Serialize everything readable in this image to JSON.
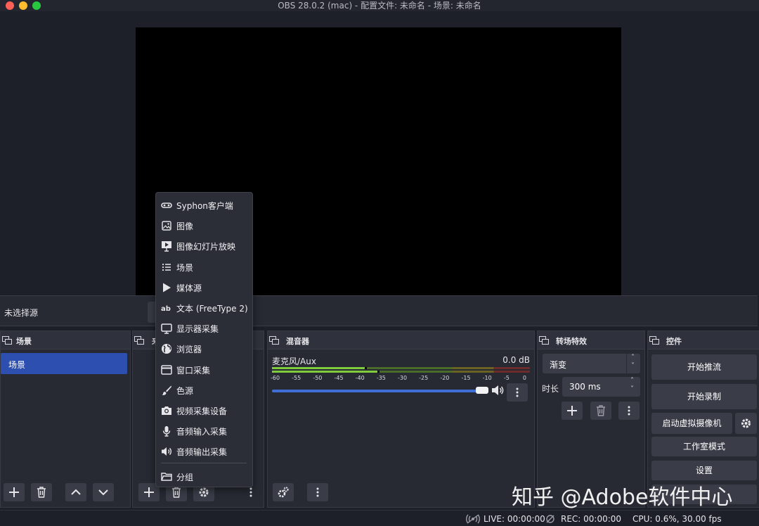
{
  "window": {
    "title": "OBS 28.0.2 (mac) - 配置文件: 未命名 - 场景: 未命名"
  },
  "source_bar": {
    "no_source": "未选择源"
  },
  "docks": {
    "scenes": {
      "title": "场景",
      "items": [
        {
          "label": "场景"
        }
      ]
    },
    "sources": {
      "title": "来"
    },
    "mixer": {
      "title": "混音器",
      "track": {
        "name": "麦克风/Aux",
        "level": "0.0 dB"
      },
      "scale": [
        "-60",
        "-55",
        "-50",
        "-45",
        "-40",
        "-35",
        "-30",
        "-25",
        "-20",
        "-15",
        "-10",
        "-5",
        "0"
      ]
    },
    "transitions": {
      "title": "转场特效",
      "type": "渐变",
      "duration_label": "时长",
      "duration_value": "300 ms"
    },
    "controls": {
      "title": "控件",
      "start_streaming": "开始推流",
      "start_recording": "开始录制",
      "start_virtual_camera": "启动虚拟摄像机",
      "studio_mode": "工作室模式",
      "settings": "设置"
    }
  },
  "context_menu": {
    "items": [
      {
        "label": "Syphon客户端",
        "icon": "syphon-icon"
      },
      {
        "label": "图像",
        "icon": "image-icon"
      },
      {
        "label": "图像幻灯片放映",
        "icon": "slideshow-icon"
      },
      {
        "label": "场景",
        "icon": "list-icon"
      },
      {
        "label": "媒体源",
        "icon": "play-icon"
      },
      {
        "label": "文本 (FreeType 2)",
        "icon": "text-icon"
      },
      {
        "label": "显示器采集",
        "icon": "monitor-icon"
      },
      {
        "label": "浏览器",
        "icon": "globe-icon"
      },
      {
        "label": "窗口采集",
        "icon": "window-icon"
      },
      {
        "label": "色源",
        "icon": "brush-icon"
      },
      {
        "label": "视频采集设备",
        "icon": "camera-icon"
      },
      {
        "label": "音频输入采集",
        "icon": "microphone-icon"
      },
      {
        "label": "音频输出采集",
        "icon": "speaker-icon"
      },
      {
        "label": "分组",
        "icon": "folder-icon"
      }
    ]
  },
  "status": {
    "live": "LIVE: 00:00:00",
    "rec": "REC: 00:00:00",
    "cpu": "CPU: 0.6%, 30.00 fps"
  },
  "watermark": "知乎 @Adobe软件中心",
  "colors": {
    "accent": "#2d4fb0",
    "volume": "#3f6fd6",
    "meter_green": "#7fcb3c"
  }
}
